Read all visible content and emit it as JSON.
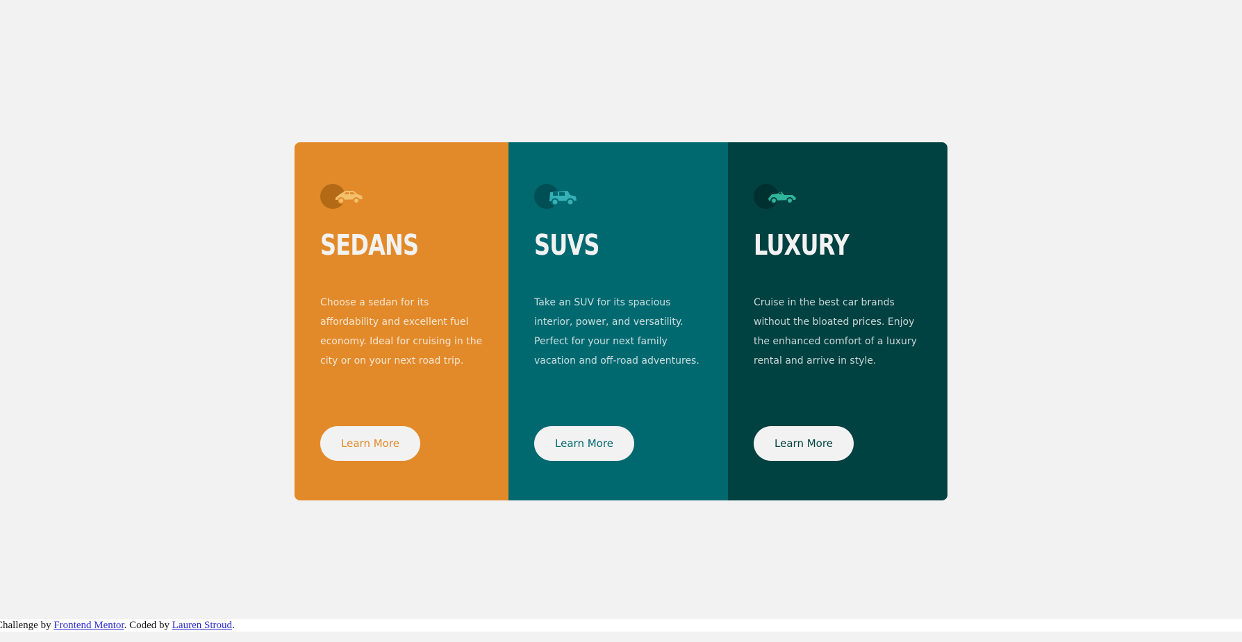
{
  "cards": [
    {
      "title": "SEDANS",
      "description": "Choose a sedan for its affordability and excellent fuel economy. Ideal for cruising in the city or on your next road trip.",
      "button_label": "Learn More",
      "icon": "sedan-car-icon",
      "color": "#e28a29"
    },
    {
      "title": "SUVS",
      "description": "Take an SUV for its spacious interior, power, and versatility. Perfect for your next family vacation and off-road adventures.",
      "button_label": "Learn More",
      "icon": "suv-car-icon",
      "color": "#006970"
    },
    {
      "title": "LUXURY",
      "description": "Cruise in the best car brands without the bloated prices. Enjoy the enhanced comfort of a luxury rental and arrive in style.",
      "button_label": "Learn More",
      "icon": "luxury-car-icon",
      "color": "#004141"
    }
  ],
  "attribution": {
    "prefix": "Challenge by ",
    "link1": "Frontend Mentor",
    "middle": ". Coded by ",
    "link2": "Lauren Stroud",
    "suffix": "."
  },
  "colors": {
    "background": "#f2f2f2",
    "sedan_icon": "#f3c06d",
    "suv_icon": "#36b0b6",
    "luxury_icon": "#2eb59a"
  }
}
